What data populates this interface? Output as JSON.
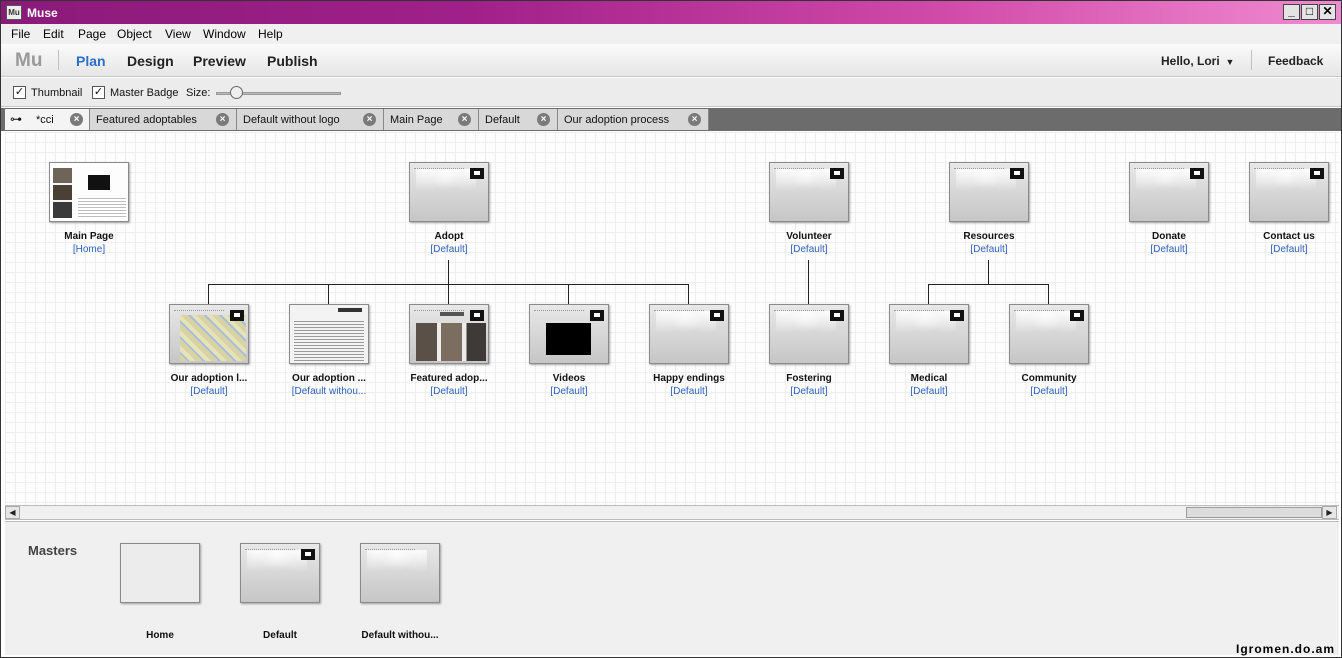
{
  "window": {
    "title": "Muse",
    "icon_text": "Mu",
    "minimize_icon": "minimize-icon",
    "maximize_icon": "maximize-icon",
    "close_icon": "close-icon"
  },
  "menu": [
    "File",
    "Edit",
    "Page",
    "Object",
    "View",
    "Window",
    "Help"
  ],
  "appbar": {
    "logo": "Mu",
    "modes": [
      "Plan",
      "Design",
      "Preview",
      "Publish"
    ],
    "active_mode": "Plan",
    "user": "Hello, Lori",
    "feedback": "Feedback"
  },
  "options": {
    "thumbnail_label": "Thumbnail",
    "thumbnail_checked": true,
    "master_badge_label": "Master Badge",
    "master_badge_checked": true,
    "size_label": "Size:",
    "size_value": 0.12
  },
  "tabs": [
    {
      "label": "*cci",
      "icon": "sitemap-icon",
      "active": true
    },
    {
      "label": "Featured adoptables"
    },
    {
      "label": "Default without logo"
    },
    {
      "label": "Main Page"
    },
    {
      "label": "Default"
    },
    {
      "label": "Our adoption process"
    }
  ],
  "sitemap": {
    "top": [
      {
        "name": "Main Page",
        "master": "[Home]"
      },
      {
        "name": "Adopt",
        "master": "[Default]"
      },
      {
        "name": "Volunteer",
        "master": "[Default]"
      },
      {
        "name": "Resources",
        "master": "[Default]"
      },
      {
        "name": "Donate",
        "master": "[Default]"
      },
      {
        "name": "Contact us",
        "master": "[Default]"
      }
    ],
    "children": [
      {
        "name": "Our adoption l...",
        "master": "[Default]"
      },
      {
        "name": "Our adoption ...",
        "master": "[Default withou..."
      },
      {
        "name": "Featured adop...",
        "master": "[Default]"
      },
      {
        "name": "Videos",
        "master": "[Default]"
      },
      {
        "name": "Happy endings",
        "master": "[Default]"
      },
      {
        "name": "Fostering",
        "master": "[Default]"
      },
      {
        "name": "Medical",
        "master": "[Default]"
      },
      {
        "name": "Community",
        "master": "[Default]"
      }
    ]
  },
  "masters": {
    "title": "Masters",
    "items": [
      {
        "name": "Home"
      },
      {
        "name": "Default"
      },
      {
        "name": "Default withou..."
      }
    ]
  },
  "watermark": "Igromen.do.am",
  "colors": {
    "title_bar_start": "#8a1a7a",
    "title_bar_end": "#f08ad0",
    "active_mode": "#2a6fc9",
    "master_link": "#2a5fbf"
  }
}
